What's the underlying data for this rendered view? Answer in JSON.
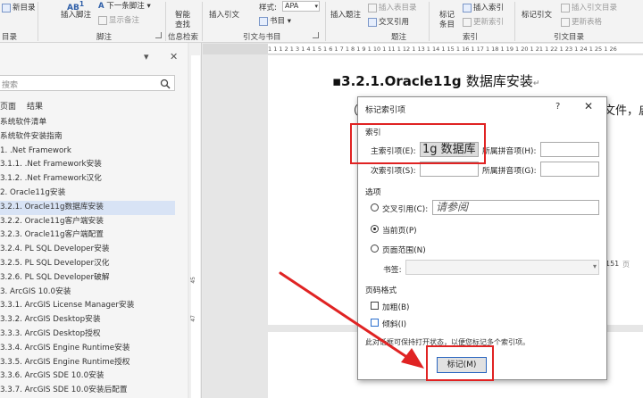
{
  "ribbon": {
    "toc": {
      "label": "新目录",
      "group": "目录"
    },
    "footnote": {
      "insert": "插入脚注",
      "next": "下一条脚注",
      "show": "显示备注",
      "ab_glyph": "AB",
      "ab_sup": "1",
      "group": "脚注"
    },
    "research": {
      "search": "智能",
      "search2": "查找",
      "group": "信息检索"
    },
    "citations": {
      "insert": "插入引文",
      "insert2": "",
      "style_label": "样式:",
      "style_value": "APA",
      "bibliography": "书目",
      "group": "引文与书目"
    },
    "captions": {
      "insert": "插入题注",
      "table": "插入表目录",
      "cross_ref": "交叉引用",
      "group": "题注"
    },
    "index": {
      "mark": "标记",
      "mark2": "条目",
      "insert": "插入索引",
      "update": "更新索引",
      "group": "索引"
    },
    "toa": {
      "mark": "标记引文",
      "insert": "插入引文目录",
      "update": "更新表格",
      "group": "引文目录"
    },
    "icons": [
      "arrow-icon"
    ]
  },
  "nav": {
    "search_placeholder": "搜索",
    "tabs": [
      "页面",
      "结果"
    ],
    "dropdown_glyph": "▾",
    "close_glyph": "✕",
    "items": [
      "系统软件清单",
      "系统软件安装指南",
      "1. .Net Framework",
      "3.1.1. .Net Framework安装",
      "3.1.2. .Net Framework汉化",
      "2. Oracle11g安装",
      "3.2.1. Oracle11g数据库安装",
      "3.2.2. Oracle11g客户端安装",
      "3.2.3. Oracle11g客户端配置",
      "3.2.4. PL SQL Developer安装",
      "3.2.5. PL SQL Developer汉化",
      "3.2.6. PL SQL Developer破解",
      "3. ArcGIS 10.0安装",
      "3.3.1. ArcGIS License Manager安装",
      "3.3.2. ArcGIS Desktop安装",
      "3.3.3. ArcGIS Desktop授权",
      "3.3.4. ArcGIS Engine Runtime安装",
      "3.3.5. ArcGIS Engine Runtime授权",
      "3.3.6. ArcGIS SDE 10.0安装",
      "3.3.7. ArcGIS SDE 10.0安装后配置"
    ],
    "selected_index": 6
  },
  "ruler": {
    "h_text": "1  1  1  2  1  3  1  4  1  5  1  6  1  7  1  8  1  9  1  10  1  11  1  12  1  13  1  14  1  15  1  16  1  17  1  18  1  19  1  20  1  21  1  22  1  23  1  24  1  25  1  26",
    "v_numbers": [
      "45",
      "4",
      "43",
      "42",
      "41",
      "40",
      "5",
      "47",
      "8"
    ]
  },
  "document": {
    "heading_num": "3.2.1.Oracle11g ",
    "heading_cjk": "数据库安装",
    "frag_left": "（1",
    "frag_right": "文件，启",
    "page_num": "151",
    "page_suffix": "页"
  },
  "dialog": {
    "title": "标记索引项",
    "help": "?",
    "close": "✕",
    "section_index": "索引",
    "main_entry_label": "主索引项(E):",
    "main_entry_value": "1g 数据库",
    "sub_entry_label": "次索引项(S):",
    "pinyin_main_label": "所属拼音项(H):",
    "pinyin_sub_label": "所属拼音项(G):",
    "section_options": "选项",
    "opt_cross_ref": "交叉引用(C):",
    "cross_ref_value": "请参阅",
    "opt_current_page": "当前页(P)",
    "opt_page_range": "页面范围(N)",
    "bookmark_label": "书签:",
    "section_format": "页码格式",
    "fmt_bold": "加粗(B)",
    "fmt_italic": "倾斜(I)",
    "hint": "此对话框可保持打开状态，以便您标记多个索引项。",
    "mark_button": "标记(M)"
  },
  "annotations": {
    "highlight_color": "#e02323"
  }
}
